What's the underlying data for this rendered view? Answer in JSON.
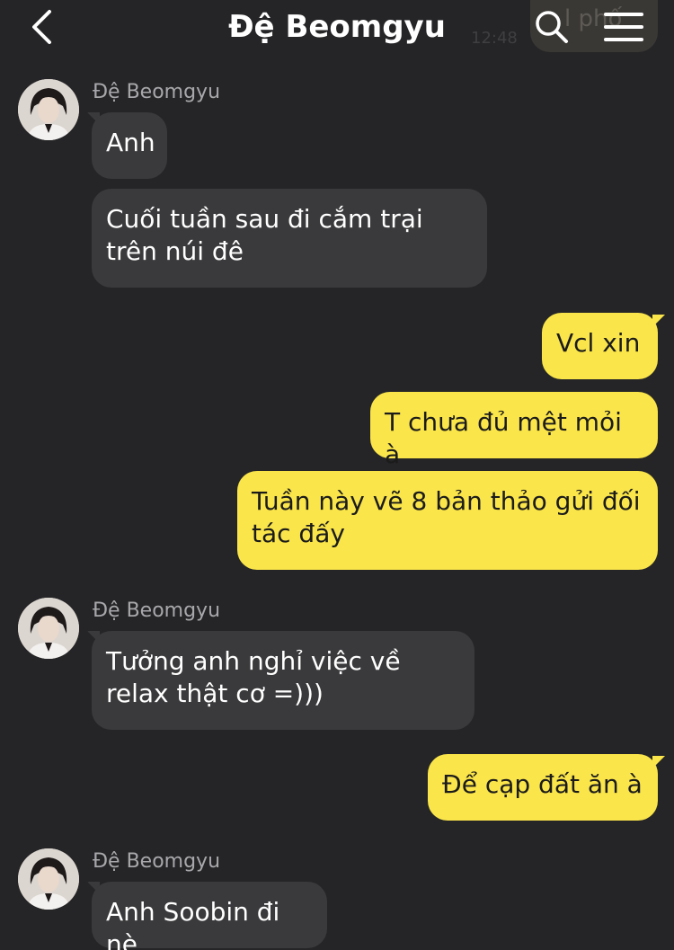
{
  "header": {
    "title": "Đệ Beomgyu",
    "back_icon": "chevron-left-icon",
    "search_icon": "search-icon",
    "menu_icon": "hamburger-menu-icon",
    "ghost_bubble_text": "l phố",
    "ghost_time": "12:48"
  },
  "colors": {
    "background": "#252527",
    "incoming_bubble": "#3a3a3c",
    "outgoing_bubble": "#fae54a",
    "sender_name": "#a8a8ac"
  },
  "messages": [
    {
      "direction": "in",
      "sender": "Đệ Beomgyu",
      "text": "Anh"
    },
    {
      "direction": "in",
      "text": "Cuối tuần sau đi cắm trại trên núi đê"
    },
    {
      "direction": "out",
      "text": "Vcl xin"
    },
    {
      "direction": "out",
      "text": "T chưa đủ mệt mỏi à"
    },
    {
      "direction": "out",
      "text": "Tuần này vẽ 8 bản thảo gửi đối tác đấy"
    },
    {
      "direction": "in",
      "sender": "Đệ Beomgyu",
      "text": "Tưởng anh nghỉ việc về relax thật cơ =)))"
    },
    {
      "direction": "out",
      "text": "Để cạp đất ăn à"
    },
    {
      "direction": "in",
      "sender": "Đệ Beomgyu",
      "text": "Anh Soobin đi nè"
    }
  ]
}
